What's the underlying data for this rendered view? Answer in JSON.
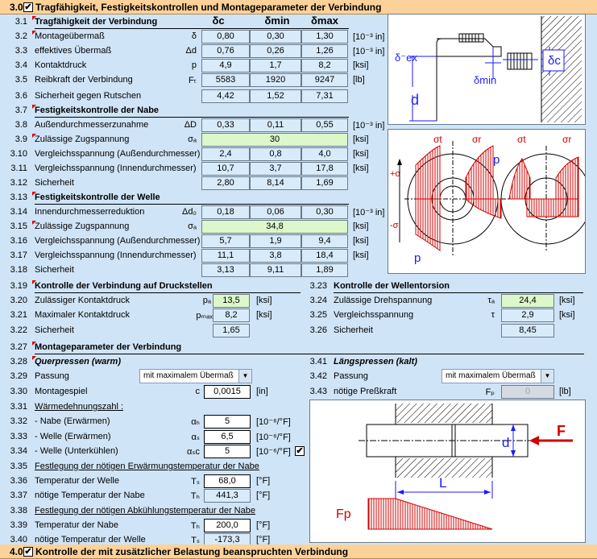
{
  "section3": {
    "num": "3.0",
    "title": "Tragfähigkeit, Festigkeitskontrollen und Montageparameter der Verbindung"
  },
  "section4": {
    "num": "4.0",
    "title": "Kontrolle der mit zusätzlicher Belastung beanspruchten Verbindung"
  },
  "checkmark": "✔",
  "colheaders": [
    "δc",
    "δmin",
    "δmax"
  ],
  "rows": {
    "r31": {
      "num": "3.1",
      "label": "Tragfähigkeit der Verbindung"
    },
    "r32": {
      "num": "3.2",
      "label": "Montageübermaß",
      "sym": "δ",
      "v": [
        "0,80",
        "0,30",
        "1,30"
      ],
      "unit": "[10⁻³ in]"
    },
    "r33": {
      "num": "3.3",
      "label": "effektives Übermaß",
      "sym": "Δd",
      "v": [
        "0,76",
        "0,26",
        "1,26"
      ],
      "unit": "[10⁻³ in]"
    },
    "r34": {
      "num": "3.4",
      "label": "Kontaktdruck",
      "sym": "p",
      "v": [
        "4,9",
        "1,7",
        "8,2"
      ],
      "unit": "[ksi]"
    },
    "r35": {
      "num": "3.5",
      "label": "Reibkraft der Verbindung",
      "sym": "Fₜ",
      "v": [
        "5583",
        "1920",
        "9247"
      ],
      "unit": "[lb]"
    },
    "r36": {
      "num": "3.6",
      "label": "Sicherheit gegen Rutschen",
      "sym": "",
      "v": [
        "4,42",
        "1,52",
        "7,31"
      ],
      "unit": ""
    },
    "r37": {
      "num": "3.7",
      "label": "Festigkeitskontrolle der Nabe"
    },
    "r38": {
      "num": "3.8",
      "label": "Außendurchmesserzunahme",
      "sym": "ΔD",
      "v": [
        "0,33",
        "0,11",
        "0,55"
      ],
      "unit": "[10⁻³ in]"
    },
    "r39": {
      "num": "3.9",
      "label": "Zulässige Zugspannung",
      "sym": "σₐ",
      "v": [
        "30"
      ],
      "unit": "[ksi]"
    },
    "r310": {
      "num": "3.10",
      "label": "Vergleichsspannung (Außendurchmesser)",
      "sym": "",
      "v": [
        "2,4",
        "0,8",
        "4,0"
      ],
      "unit": "[ksi]"
    },
    "r311": {
      "num": "3.11",
      "label": "Vergleichsspannung (Innendurchmesser)",
      "sym": "",
      "v": [
        "10,7",
        "3,7",
        "17,8"
      ],
      "unit": "[ksi]"
    },
    "r312": {
      "num": "3.12",
      "label": "Sicherheit",
      "sym": "",
      "v": [
        "2,80",
        "8,14",
        "1,69"
      ],
      "unit": ""
    },
    "r313": {
      "num": "3.13",
      "label": "Festigkeitskontrolle der Welle"
    },
    "r314": {
      "num": "3.14",
      "label": "Innendurchmesserreduktion",
      "sym": "Δd₀",
      "v": [
        "0,18",
        "0,06",
        "0,30"
      ],
      "unit": "[10⁻³ in]"
    },
    "r315": {
      "num": "3.15",
      "label": "Zulässige Zugspannung",
      "sym": "σₐ",
      "v": [
        "34,8"
      ],
      "unit": "[ksi]"
    },
    "r316": {
      "num": "3.16",
      "label": "Vergleichsspannung (Außendurchmesser)",
      "sym": "",
      "v": [
        "5,7",
        "1,9",
        "9,4"
      ],
      "unit": "[ksi]"
    },
    "r317": {
      "num": "3.17",
      "label": "Vergleichsspannung (Innendurchmesser)",
      "sym": "",
      "v": [
        "11,1",
        "3,8",
        "18,4"
      ],
      "unit": "[ksi]"
    },
    "r318": {
      "num": "3.18",
      "label": "Sicherheit",
      "sym": "",
      "v": [
        "3,13",
        "9,11",
        "1,89"
      ],
      "unit": ""
    }
  },
  "druck": {
    "r319": {
      "num": "3.19",
      "label": "Kontrolle der Verbindung auf Druckstellen"
    },
    "r320": {
      "num": "3.20",
      "label": "Zulässiger Kontaktdruck",
      "sym": "pₐ",
      "v": "13,5",
      "unit": "[ksi]"
    },
    "r321": {
      "num": "3.21",
      "label": "Maximaler Kontaktdruck",
      "sym": "pₘₐₓ",
      "v": "8,2",
      "unit": "[ksi]"
    },
    "r322": {
      "num": "3.22",
      "label": "Sicherheit",
      "v": "1,65"
    }
  },
  "torsion": {
    "r323": {
      "num": "3.23",
      "label": "Kontrolle der Wellentorsion"
    },
    "r324": {
      "num": "3.24",
      "label": "Zulässige Drehspannung",
      "sym": "τₐ",
      "v": "24,4",
      "unit": "[ksi]"
    },
    "r325": {
      "num": "3.25",
      "label": "Vergleichsspannung",
      "sym": "τ",
      "v": "2,9",
      "unit": "[ksi]"
    },
    "r326": {
      "num": "3.26",
      "label": "Sicherheit",
      "v": "8,45"
    }
  },
  "montage": {
    "r327": {
      "num": "3.27",
      "label": "Montageparameter der Verbindung"
    },
    "r328": {
      "num": "3.28",
      "label": "Querpressen (warm)"
    },
    "r329": {
      "num": "3.29",
      "label": "Passung",
      "select": "mit maximalem Übermaß"
    },
    "r330": {
      "num": "3.30",
      "label": "Montagespiel",
      "sym": "c",
      "v": "0,0015",
      "unit": "[in]"
    },
    "r331": {
      "num": "3.31",
      "label": "Wärmedehnungszahl :"
    },
    "r332": {
      "num": "3.32",
      "label": "- Nabe  (Erwärmen)",
      "sym": "αₕ",
      "v": "5",
      "unit": "[10⁻⁶/°F]"
    },
    "r333": {
      "num": "3.33",
      "label": "- Welle  (Erwärmen)",
      "sym": "αₛ",
      "v": "6,5",
      "unit": "[10⁻⁶/°F]"
    },
    "r334": {
      "num": "3.34",
      "label": "- Welle  (Unterkühlen)",
      "sym": "αₛc",
      "v": "5",
      "unit": "[10⁻⁶/°F]"
    },
    "r335": {
      "num": "3.35",
      "label": "Festlegung der nötigen Erwärmungstemperatur der Nabe"
    },
    "r336": {
      "num": "3.36",
      "label": "Temperatur der Welle",
      "sym": "Tₛ",
      "v": "68,0",
      "unit": "[°F]"
    },
    "r337": {
      "num": "3.37",
      "label": "nötige Temperatur der Nabe",
      "sym": "Tₕ",
      "v": "441,3",
      "unit": "[°F]"
    },
    "r338": {
      "num": "3.38",
      "label": "Festlegung der nötigen Abkühlungstemperatur der Nabe"
    },
    "r339": {
      "num": "3.39",
      "label": "Temperatur der Nabe",
      "sym": "Tₕ",
      "v": "200,0",
      "unit": "[°F]"
    },
    "r340": {
      "num": "3.40",
      "label": "nötige Temperatur der Welle",
      "sym": "Tₛ",
      "v": "-173,3",
      "unit": "[°F]"
    }
  },
  "laengs": {
    "r341": {
      "num": "3.41",
      "label": "Längspressen (kalt)"
    },
    "r342": {
      "num": "3.42",
      "label": "Passung",
      "select": "mit maximalem Übermaß"
    },
    "r343": {
      "num": "3.43",
      "label": "nötige Preßkraft",
      "sym": "Fₚ",
      "v": "0",
      "unit": "[lb]"
    }
  },
  "diagram1": {
    "dex": "δ⁻ex",
    "dc": "δc",
    "dmin": "δmin",
    "d": "d"
  },
  "diagram2": {
    "st": "σt",
    "sr": "σr",
    "p": "p",
    "plus": "+σ",
    "minus": "-σ"
  },
  "diagram3": {
    "F": "F",
    "d": "d",
    "L": "L",
    "Fp": "Fp"
  }
}
